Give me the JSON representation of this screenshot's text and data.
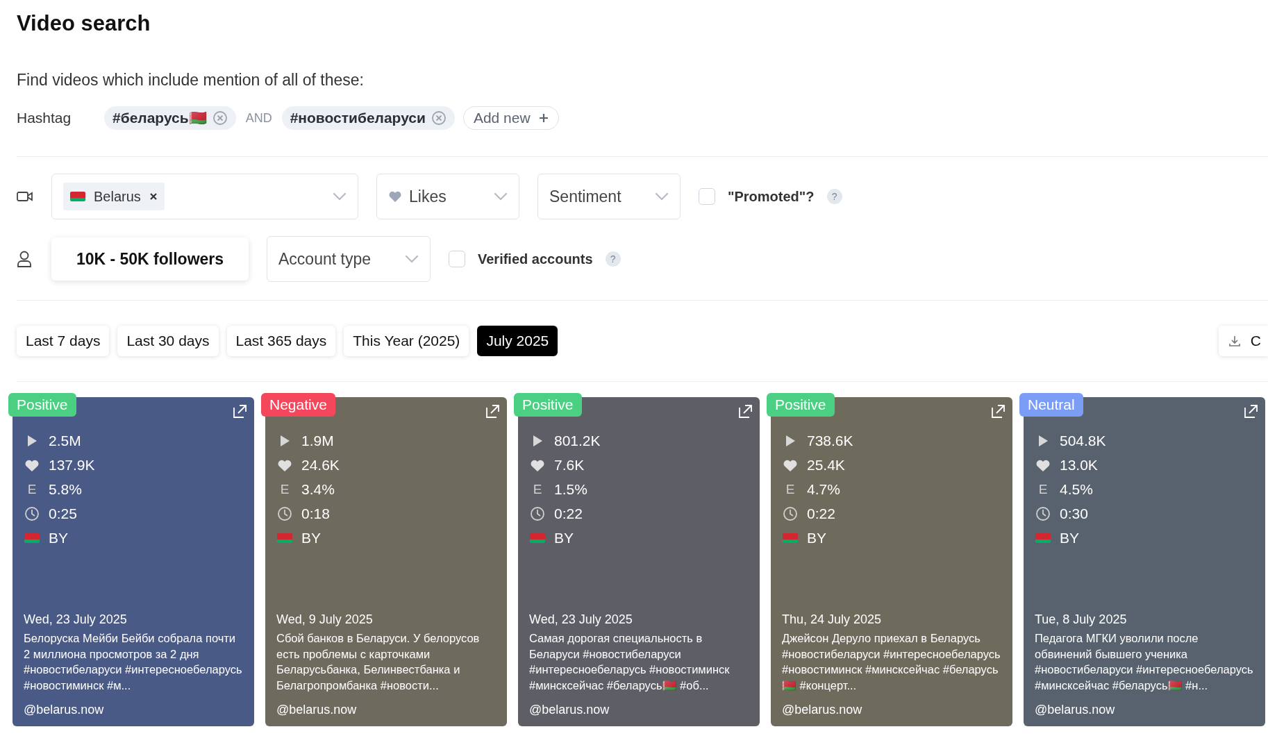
{
  "title": "Video search",
  "query": {
    "prompt": "Find videos which include mention of all of these:",
    "label": "Hashtag",
    "operator": "AND",
    "hashtags": [
      "#беларусь🇧🇾",
      "#новостибеларуси"
    ],
    "add_new": "Add new"
  },
  "video_filters": {
    "country": "Belarus",
    "likes": "Likes",
    "sentiment": "Sentiment",
    "promoted": {
      "label": "\"Promoted\"?",
      "checked": false,
      "help": "?"
    }
  },
  "account_filters": {
    "followers": "10K - 50K followers",
    "account_type": "Account type",
    "verified": {
      "label": "Verified accounts",
      "checked": false,
      "help": "?"
    }
  },
  "date_ranges": [
    {
      "label": "Last 7 days",
      "selected": false
    },
    {
      "label": "Last 30 days",
      "selected": false
    },
    {
      "label": "Last 365 days",
      "selected": false
    },
    {
      "label": "This Year (2025)",
      "selected": false
    },
    {
      "label": "July 2025",
      "selected": true
    }
  ],
  "export_button": "C",
  "videos": [
    {
      "sentiment": "Positive",
      "color": "#4bd083",
      "views": "2.5M",
      "likes": "137.9K",
      "engagement_label": "E",
      "engagement": "5.8%",
      "duration": "0:25",
      "country": "BY",
      "date": "Wed, 23 July 2025",
      "description": "Белоруска Мейби Бейби собрала почти 2 миллиона просмотров за 2 дня #новостибеларуси #интересноебеларусь #новостиминск #м...",
      "author": "@belarus.now"
    },
    {
      "sentiment": "Negative",
      "color": "#f4475c",
      "views": "1.9M",
      "likes": "24.6K",
      "engagement_label": "E",
      "engagement": "3.4%",
      "duration": "0:18",
      "country": "BY",
      "date": "Wed, 9 July 2025",
      "description": "Сбой банков в Беларуси. У белорусов есть проблемы с карточками Беларусьбанка, Белинвестбанка и Белагропромбанка #новости...",
      "author": "@belarus.now"
    },
    {
      "sentiment": "Positive",
      "color": "#4bd083",
      "views": "801.2K",
      "likes": "7.6K",
      "engagement_label": "E",
      "engagement": "1.5%",
      "duration": "0:22",
      "country": "BY",
      "date": "Wed, 23 July 2025",
      "description": "Самая дорогая специальность в Беларуси #новостибеларуси #интересноебеларусь #новостиминск #минсксейчас #беларусь🇧🇾 #об...",
      "author": "@belarus.now"
    },
    {
      "sentiment": "Positive",
      "color": "#4bd083",
      "views": "738.6K",
      "likes": "25.4K",
      "engagement_label": "E",
      "engagement": "4.7%",
      "duration": "0:22",
      "country": "BY",
      "date": "Thu, 24 July 2025",
      "description": "Джейсон Деруло приехал в Беларусь #новостибеларуси #интересноебеларусь #новостиминск #минсксейчас #беларусь🇧🇾 #концерт...",
      "author": "@belarus.now"
    },
    {
      "sentiment": "Neutral",
      "color": "#7c9df5",
      "views": "504.8K",
      "likes": "13.0K",
      "engagement_label": "E",
      "engagement": "4.5%",
      "duration": "0:30",
      "country": "BY",
      "date": "Tue, 8 July 2025",
      "description": "Педагога МГКИ уволили после обвинений бывшего ученика #новостибеларуси #интересноебеларусь #минсксейчас #беларусь🇧🇾 #н...",
      "author": "@belarus.now"
    }
  ]
}
